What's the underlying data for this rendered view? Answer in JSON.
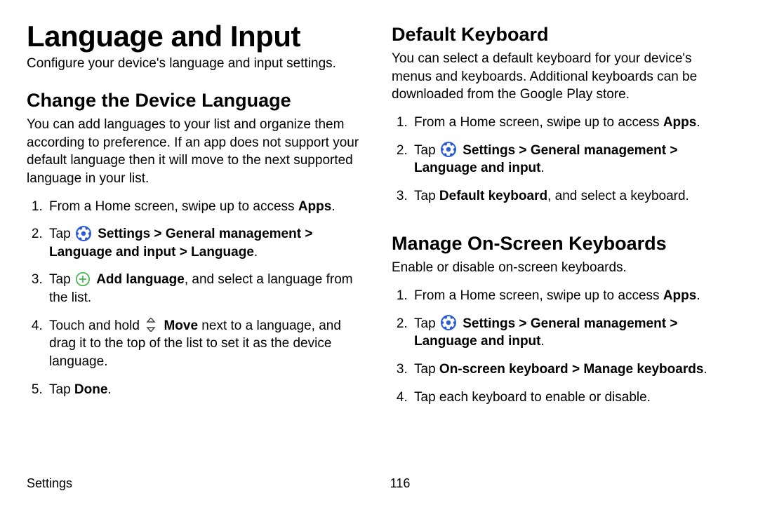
{
  "page": {
    "title": "Language and Input",
    "subtitle": "Configure your device's language and input settings."
  },
  "left": {
    "section1_title": "Change the Device Language",
    "section1_desc": "You can add languages to your list and organize them according to preference. If an app does not support your default language then it will move to the next supported language in your list.",
    "steps": {
      "s1_a": "From a Home screen, swipe up to access ",
      "s1_b": "Apps",
      "s1_c": ".",
      "s2_a": "Tap ",
      "s2_b": "Settings",
      "s2_c": "General management",
      "s2_d": "Language and input",
      "s2_e": "Language",
      "s2_f": ".",
      "s3_a": "Tap ",
      "s3_b": "Add language",
      "s3_c": ", and select a language from the list.",
      "s4_a": "Touch and hold ",
      "s4_b": "Move",
      "s4_c": " next to a language, and drag it to the top of the list to set it as the device language.",
      "s5_a": "Tap ",
      "s5_b": "Done",
      "s5_c": "."
    }
  },
  "right": {
    "section1_title": "Default Keyboard",
    "section1_desc": "You can select a default keyboard for your device's menus and keyboards. Additional keyboards can be downloaded from the Google Play store.",
    "steps1": {
      "s1_a": "From a Home screen, swipe up to access ",
      "s1_b": "Apps",
      "s1_c": ".",
      "s2_a": "Tap ",
      "s2_b": "Settings",
      "s2_c": "General management",
      "s2_d": "Language and input",
      "s2_e": ".",
      "s3_a": "Tap ",
      "s3_b": "Default keyboard",
      "s3_c": ", and select a keyboard."
    },
    "section2_title": "Manage On-Screen Keyboards",
    "section2_desc": "Enable or disable on-screen keyboards.",
    "steps2": {
      "s1_a": "From a Home screen, swipe up to access ",
      "s1_b": "Apps",
      "s1_c": ".",
      "s2_a": "Tap ",
      "s2_b": "Settings",
      "s2_c": "General management",
      "s2_d": "Language and input",
      "s2_e": ".",
      "s3_a": "Tap ",
      "s3_b": "On-screen keyboard",
      "s3_c": "Manage keyboards",
      "s3_d": ".",
      "s4_a": "Tap each keyboard to enable or disable."
    }
  },
  "footer": {
    "left": "Settings",
    "page": "116"
  },
  "sep": " > "
}
